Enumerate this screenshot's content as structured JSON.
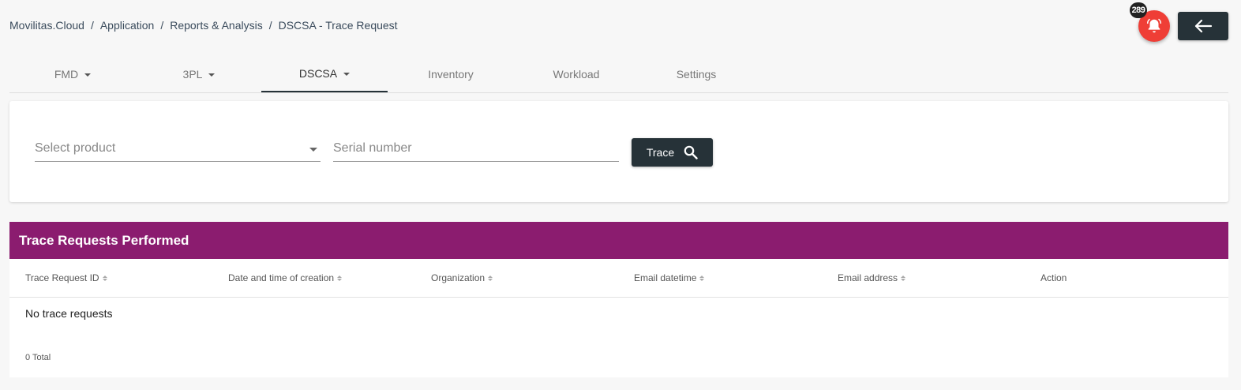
{
  "breadcrumb": [
    {
      "label": "Movilitas.Cloud"
    },
    {
      "label": "Application"
    },
    {
      "label": "Reports & Analysis"
    },
    {
      "label": "DSCSA - Trace Request"
    }
  ],
  "breadcrumb_separator": "/",
  "notifications": {
    "count": "289",
    "icon": "bell-icon",
    "color": "#ef3e36"
  },
  "back_button": {
    "icon": "arrow-left-icon"
  },
  "tabs": [
    {
      "label": "FMD",
      "dropdown": true
    },
    {
      "label": "3PL",
      "dropdown": true
    },
    {
      "label": "DSCSA",
      "dropdown": true,
      "active": true
    },
    {
      "label": "Inventory"
    },
    {
      "label": "Workload"
    },
    {
      "label": "Settings"
    }
  ],
  "search": {
    "product_placeholder": "Select product",
    "serial_placeholder": "Serial number",
    "trace_label": "Trace"
  },
  "table": {
    "title": "Trace Requests Performed",
    "header_color": "#8b1c6f",
    "columns": [
      {
        "label": "Trace Request ID",
        "sortable": true
      },
      {
        "label": "Date and time of creation",
        "sortable": true
      },
      {
        "label": "Organization",
        "sortable": true
      },
      {
        "label": "Email datetime",
        "sortable": true
      },
      {
        "label": "Email address",
        "sortable": true
      },
      {
        "label": "Action",
        "sortable": false
      }
    ],
    "empty_message": "No trace requests",
    "total": "0 Total"
  }
}
